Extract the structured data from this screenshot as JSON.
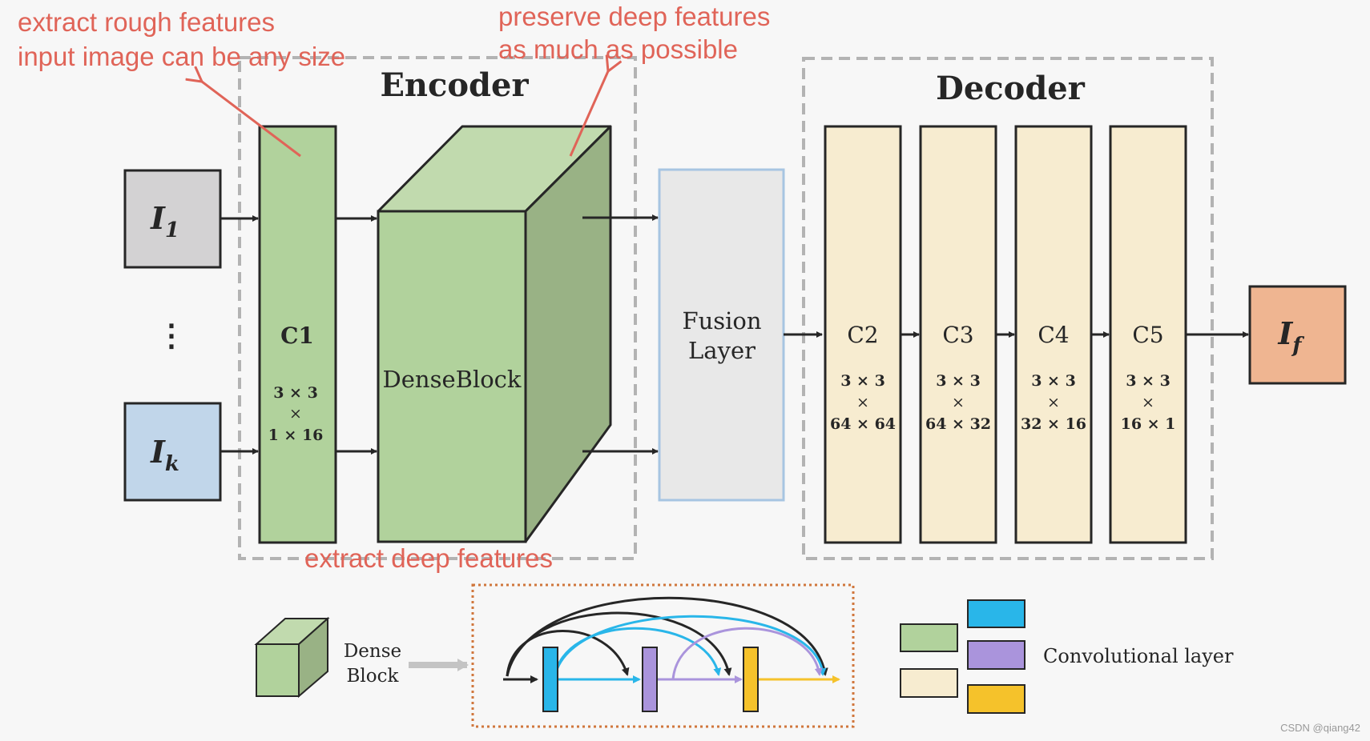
{
  "annotations": {
    "rough_line1": "extract rough features",
    "rough_line2": "input image can be any size",
    "preserve_line1": "preserve deep features",
    "preserve_line2": "as much as possible",
    "deep": "extract deep features"
  },
  "encoder": {
    "title": "Encoder",
    "c1": {
      "name": "C1",
      "k1": "3 × 3",
      "x": "×",
      "k2": "1 × 16"
    },
    "denseblock": "DenseBlock"
  },
  "inputs": {
    "i1": {
      "base": "I",
      "sub": "1"
    },
    "dots": "⋮",
    "ik": {
      "base": "I",
      "sub": "k"
    }
  },
  "fusion": {
    "line1": "Fusion",
    "line2": "Layer"
  },
  "decoder": {
    "title": "Decoder",
    "layers": [
      {
        "name": "C2",
        "k1": "3 × 3",
        "x": "×",
        "k2": "64 × 64"
      },
      {
        "name": "C3",
        "k1": "3 × 3",
        "x": "×",
        "k2": "64 × 32"
      },
      {
        "name": "C4",
        "k1": "3 × 3",
        "x": "×",
        "k2": "32 × 16"
      },
      {
        "name": "C5",
        "k1": "3 × 3",
        "x": "×",
        "k2": "16 × 1"
      }
    ]
  },
  "output": {
    "base": "I",
    "sub": "f"
  },
  "legend": {
    "dense_line1": "Dense",
    "dense_line2": "Block",
    "conv_label": "Convolutional layer"
  },
  "colors": {
    "input1": "#d3d2d3",
    "inputk": "#c1d6ea",
    "green": "#b1d29c",
    "green_top": "#c1daae",
    "green_side": "#99b285",
    "fusion": "#e8e8e8",
    "fusion_border": "#a7c5e2",
    "decoder": "#f7ecd0",
    "output": "#efb591",
    "blue": "#29b6e9",
    "purple": "#aa94dc",
    "yellow": "#f5c22b",
    "annotation": "#e06458",
    "dash": "#b3b3b3",
    "dotted": "#d0773d"
  },
  "watermark": "CSDN @qiang42"
}
